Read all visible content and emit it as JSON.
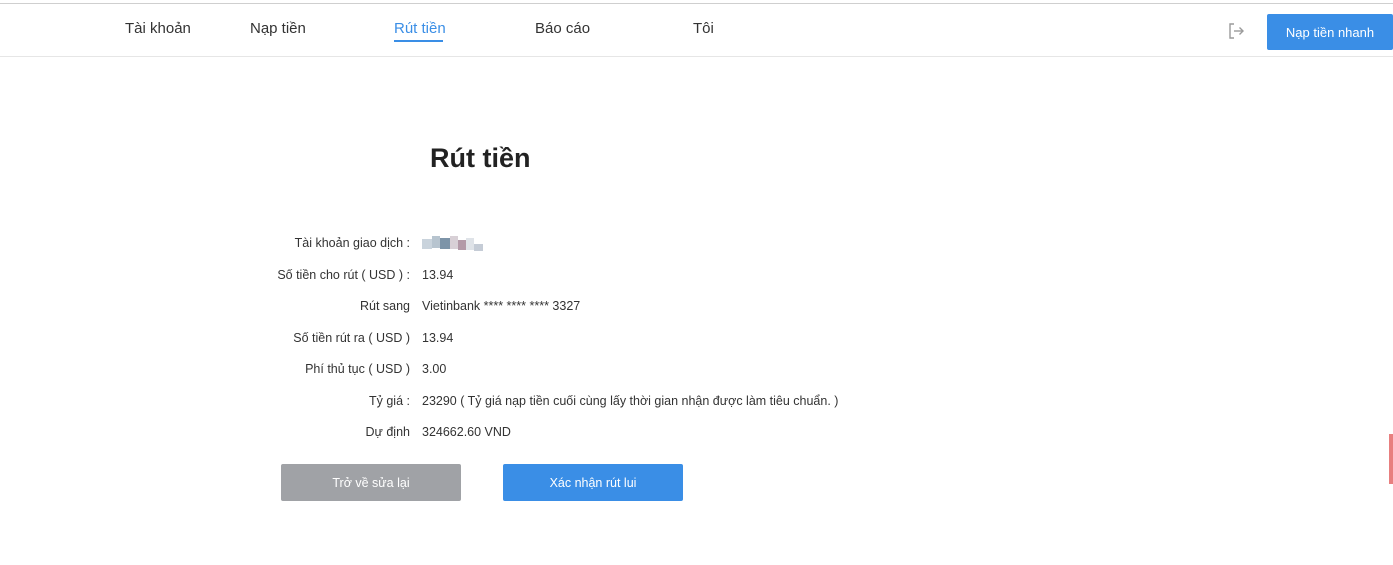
{
  "header": {
    "nav": [
      {
        "label": "Tài khoản"
      },
      {
        "label": "Nạp tiền"
      },
      {
        "label": "Rút tiền"
      },
      {
        "label": "Báo cáo"
      },
      {
        "label": "Tôi"
      }
    ],
    "active_tab": "Rút tiền",
    "logout_icon": "logout-icon",
    "quick_deposit_label": "Nạp tiền nhanh"
  },
  "page": {
    "title": "Rút tiền"
  },
  "details": {
    "account": {
      "label": "Tài khoản giao dịch :",
      "value": ""
    },
    "available": {
      "label": "Số tiền cho rút ( USD )  :",
      "value": "13.94"
    },
    "withdraw_to": {
      "label": "Rút sang",
      "value": "Vietinbank **** **** **** 3327"
    },
    "withdraw_amount": {
      "label": "Số tiền rút ra ( USD )",
      "value": "13.94"
    },
    "fee": {
      "label": "Phí thủ tục ( USD )",
      "value": "3.00"
    },
    "rate": {
      "label": "Tỷ giá :",
      "value": "23290  ( Tỷ giá nạp tiền cuối cùng lấy thời gian nhận được làm tiêu chuẩn. )"
    },
    "expected": {
      "label": "Dự định",
      "value": "324662.60 VND"
    }
  },
  "actions": {
    "back_label": "Trở về sửa lại",
    "confirm_label": "Xác nhận rút lui"
  },
  "colors": {
    "accent": "#3a8ee6",
    "disabled_button": "#a0a2a6"
  }
}
